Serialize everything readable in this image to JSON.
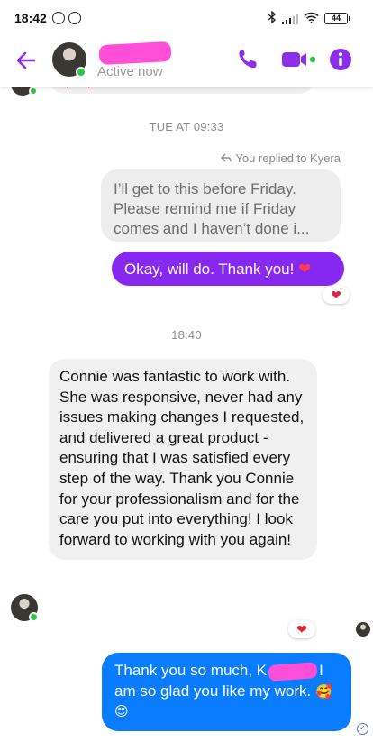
{
  "status_bar": {
    "time": "18:42",
    "battery": "44"
  },
  "header": {
    "status": "Active now",
    "colors": {
      "accent": "#8b2fe8",
      "online": "#31c24d"
    }
  },
  "conversation": {
    "timestamp_1": "TUE AT 09:33",
    "reply_note": "You replied to Kyera",
    "quoted_message": "I’ll get to this before Friday. Please remind me if Friday comes and I haven’t done i...",
    "sent_message_1": "Okay, will do. Thank you!",
    "sent_message_1_emoji": "❤",
    "timestamp_2": "18:40",
    "received_message": "Connie was fantastic to work with. She was responsive, never had any issues making changes I requested, and delivered a great product - ensuring that I was satisfied every step of the way. Thank you Connie for your professionalism and for the care you put into everything! I look forward to working with you again!",
    "sent_message_2_part1": "Thank you so much, K",
    "sent_message_2_part2": "I am so glad you like my work.",
    "sent_message_2_emoji": "🥰😍",
    "reaction_emoji": "❤",
    "colors": {
      "sent_purple": "#8728f0",
      "sent_blue": "#0a7cff",
      "received_bg": "#f0f0f0",
      "heart": "#e0243a"
    }
  }
}
